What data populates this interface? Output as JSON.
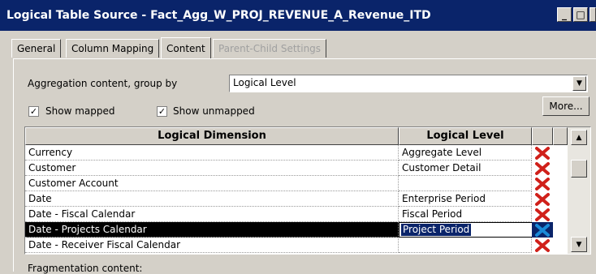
{
  "window": {
    "title": "Logical Table Source - Fact_Agg_W_PROJ_REVENUE_A_Revenue_ITD",
    "minimize_glyph": "_",
    "maximize_glyph": "□"
  },
  "tabs": [
    {
      "label": "General"
    },
    {
      "label": "Column Mapping"
    },
    {
      "label": "Content"
    },
    {
      "label": "Parent-Child Settings"
    }
  ],
  "content": {
    "aggregation_label": "Aggregation content, group by",
    "aggregation_value": "Logical Level",
    "show_mapped_label": "Show mapped",
    "show_unmapped_label": "Show unmapped",
    "more_button": "More...",
    "fragmentation_label": "Fragmentation content:"
  },
  "grid": {
    "headers": {
      "dimension": "Logical Dimension",
      "level": "Logical Level"
    },
    "rows": [
      {
        "dimension": "Currency",
        "level": "Aggregate Level"
      },
      {
        "dimension": "Customer",
        "level": "Customer Detail"
      },
      {
        "dimension": "Customer Account",
        "level": ""
      },
      {
        "dimension": "Date",
        "level": "Enterprise Period"
      },
      {
        "dimension": "Date - Fiscal Calendar",
        "level": "Fiscal Period"
      },
      {
        "dimension": "Date - Projects Calendar",
        "level": "Project Period"
      },
      {
        "dimension": "Date - Receiver Fiscal Calendar",
        "level": ""
      }
    ]
  },
  "icons": {
    "delete": "delete-x-icon",
    "checkbox": "checkmark-icon",
    "dropdown": "dropdown-arrow-icon"
  },
  "colors": {
    "titlebar": "#0a246a",
    "dialog_bg": "#d4d0c8",
    "delete_red": "#d0201a",
    "delete_selected": "#1a8ad8",
    "selection": "#000000"
  }
}
